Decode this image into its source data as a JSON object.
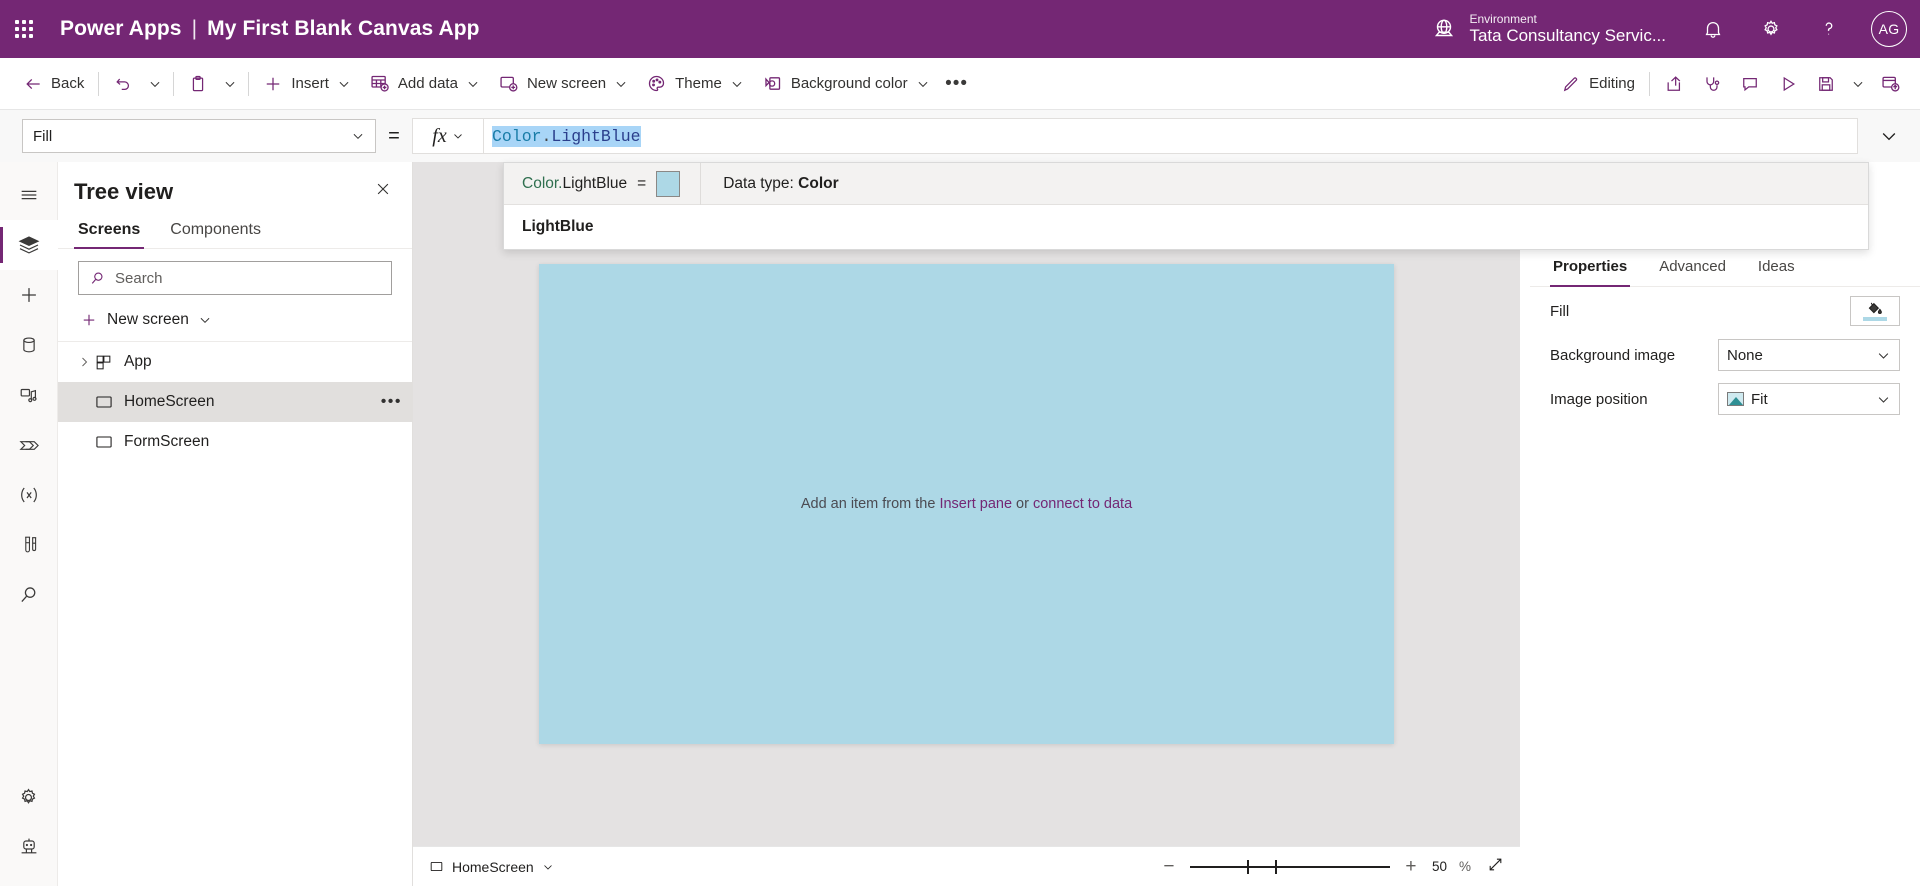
{
  "header": {
    "waffle_label": "app-launcher",
    "product": "Power Apps",
    "separator": "|",
    "app_name": "My First Blank Canvas App",
    "environment_label": "Environment",
    "environment_value": "Tata Consultancy Servic...",
    "avatar_initials": "AG",
    "brand_color": "#742774"
  },
  "commandbar": {
    "back": "Back",
    "insert": "Insert",
    "add_data": "Add data",
    "new_screen": "New screen",
    "theme": "Theme",
    "background_color": "Background color",
    "overflow": "•••",
    "editing": "Editing"
  },
  "formulabar": {
    "property": "Fill",
    "equals": "=",
    "fx": "fx",
    "expression_namespace": "Color",
    "expression_dot": ".",
    "expression_member": "LightBlue"
  },
  "intellisense": {
    "signature_prefix": "Color.",
    "signature_name": "LightBlue",
    "equals": "=",
    "swatch_color": "#add8e6",
    "datatype_label": "Data type:",
    "datatype_value": "Color",
    "description": "LightBlue"
  },
  "rail": {
    "items": [
      {
        "name": "hamburger-icon",
        "title": "Menu"
      },
      {
        "name": "layers-icon",
        "title": "Tree view"
      },
      {
        "name": "plus-icon",
        "title": "Insert"
      },
      {
        "name": "database-icon",
        "title": "Data"
      },
      {
        "name": "media-icon",
        "title": "Media"
      },
      {
        "name": "power-automate-icon",
        "title": "Power Automate"
      },
      {
        "name": "variables-icon",
        "title": "Variables"
      },
      {
        "name": "test-tubes-icon",
        "title": "App checker"
      },
      {
        "name": "search-icon",
        "title": "Search"
      }
    ],
    "bottom": [
      {
        "name": "gear-icon",
        "title": "Settings"
      },
      {
        "name": "copilot-robot-icon",
        "title": "Copilot"
      }
    ]
  },
  "treeview": {
    "title": "Tree view",
    "close_label": "Close",
    "tabs": [
      {
        "label": "Screens",
        "active": true
      },
      {
        "label": "Components",
        "active": false
      }
    ],
    "search_placeholder": "Search",
    "new_screen": "New screen",
    "rows": [
      {
        "label": "App",
        "icon": "app-grid-icon",
        "expandable": true,
        "selected": false,
        "more": false
      },
      {
        "label": "HomeScreen",
        "icon": "screen-icon",
        "expandable": false,
        "selected": true,
        "more": true
      },
      {
        "label": "FormScreen",
        "icon": "screen-icon",
        "expandable": false,
        "selected": false,
        "more": false
      }
    ]
  },
  "canvas": {
    "fill_color": "#add8e6",
    "hint_prefix": "Add an item from the ",
    "hint_link1": "Insert pane",
    "hint_middle": " or ",
    "hint_link2": "connect to data"
  },
  "statusbar": {
    "screen_name": "HomeScreen",
    "zoom_minus": "−",
    "zoom_plus": "+",
    "zoom_value": "50",
    "zoom_unit": "%"
  },
  "properties": {
    "tabs": [
      {
        "label": "Properties",
        "active": true
      },
      {
        "label": "Advanced",
        "active": false
      },
      {
        "label": "Ideas",
        "active": false
      }
    ],
    "rows": [
      {
        "label": "Fill",
        "type": "swatch",
        "value": "",
        "swatch": "#add8e6"
      },
      {
        "label": "Background image",
        "type": "dropdown",
        "value": "None"
      },
      {
        "label": "Image position",
        "type": "dropdown-icon",
        "value": "Fit"
      }
    ]
  }
}
